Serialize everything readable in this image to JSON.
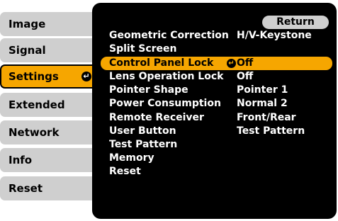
{
  "tabs": [
    {
      "label": "Image"
    },
    {
      "label": "Signal"
    },
    {
      "label": "Settings"
    },
    {
      "label": "Extended"
    },
    {
      "label": "Network"
    },
    {
      "label": "Info"
    },
    {
      "label": "Reset"
    }
  ],
  "panel": {
    "return_label": "Return",
    "rows": [
      {
        "label": "Geometric Correction",
        "value": "H/V-Keystone"
      },
      {
        "label": "Split Screen",
        "value": ""
      },
      {
        "label": "Control Panel Lock",
        "value": "Off"
      },
      {
        "label": "Lens Operation Lock",
        "value": "Off"
      },
      {
        "label": "Pointer Shape",
        "value": "Pointer 1"
      },
      {
        "label": "Power Consumption",
        "value": "Normal 2"
      },
      {
        "label": "Remote Receiver",
        "value": "Front/Rear"
      },
      {
        "label": "User Button",
        "value": "Test Pattern"
      },
      {
        "label": "Test Pattern",
        "value": ""
      },
      {
        "label": "Memory",
        "value": ""
      },
      {
        "label": "Reset",
        "value": ""
      }
    ]
  },
  "colors": {
    "accent": "#f6a600",
    "panel_bg": "#000000",
    "tab_bg": "#cfcfcf"
  },
  "icons": {
    "enter": "enter-icon"
  }
}
